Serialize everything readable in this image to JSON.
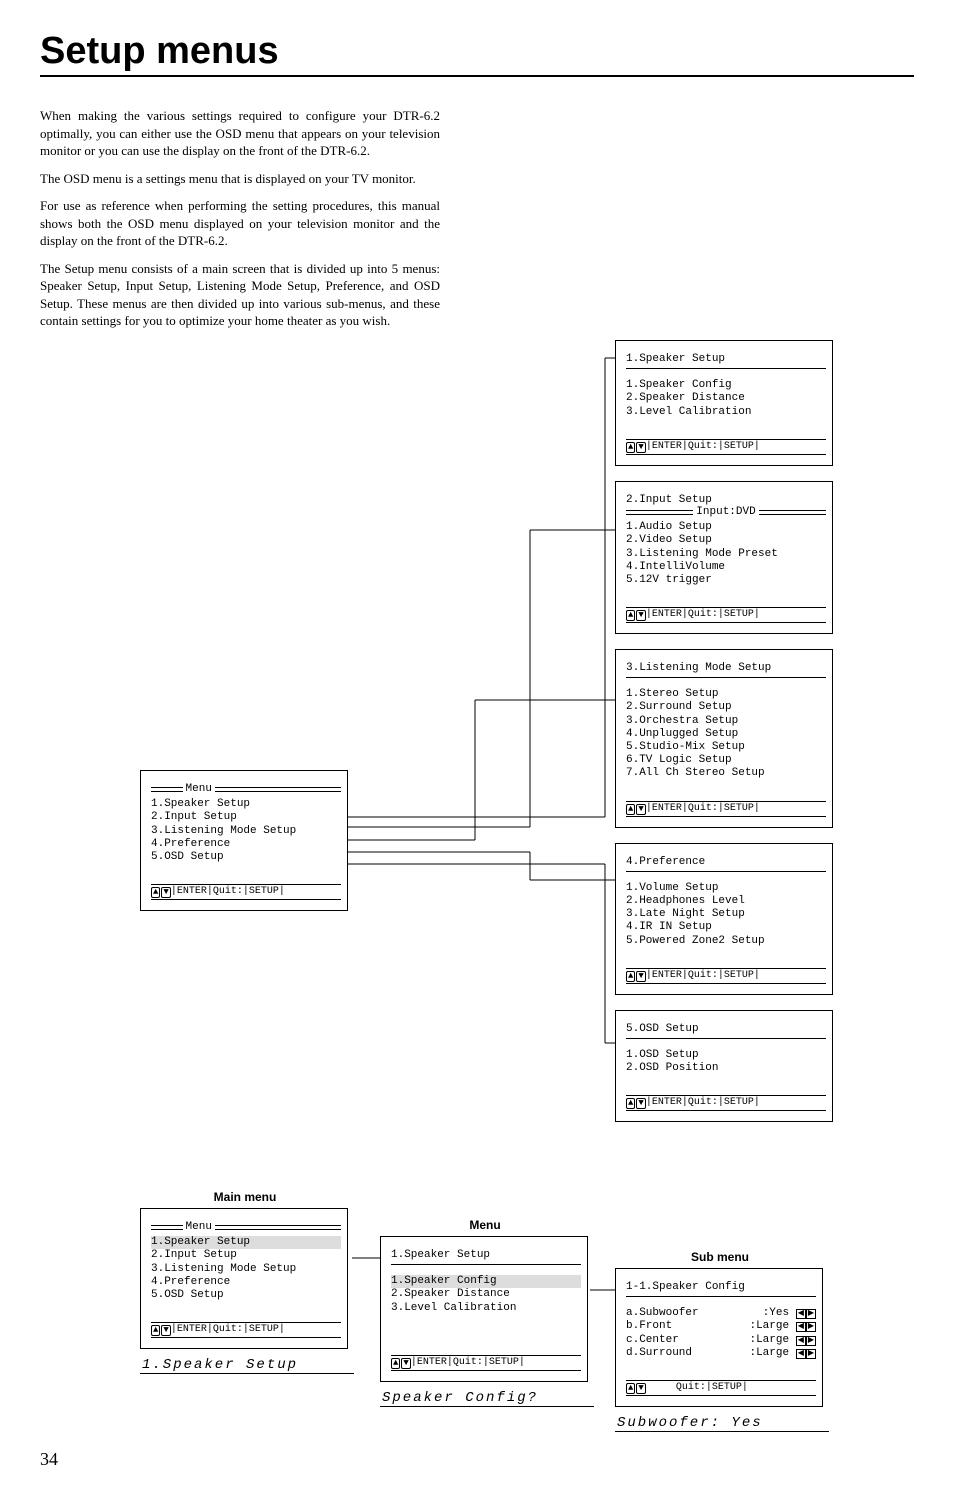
{
  "page_number": "34",
  "title": "Setup menus",
  "paragraphs": [
    "When making the various settings required to configure your DTR-6.2 optimally, you can either use the OSD menu that appears on your television monitor or you can use the display on the front of the DTR-6.2.",
    "The OSD menu is a settings menu that is displayed on your TV monitor.",
    "For use as reference when performing the setting procedures, this manual shows both the OSD menu displayed on your television monitor and the display on the front of the DTR-6.2.",
    "The Setup menu consists of a main screen that is divided up into 5 menus: Speaker Setup, Input Setup, Listening Mode Setup, Preference, and OSD Setup. These menus are then divided up into various sub-menus, and these contain settings for you to optimize your home theater as you wish."
  ],
  "footer_label": "|ENTER|Quit:|SETUP|",
  "footer_quit": "Quit:|SETUP|",
  "main_menu": {
    "title": "Menu",
    "items": [
      "1.Speaker Setup",
      "2.Input Setup",
      "3.Listening Mode Setup",
      "4.Preference",
      "5.OSD Setup"
    ]
  },
  "right_menus": [
    {
      "title": "1.Speaker Setup",
      "items": [
        "1.Speaker Config",
        "2.Speaker Distance",
        "3.Level Calibration"
      ]
    },
    {
      "title": "2.Input Setup",
      "subtitle": "Input:DVD",
      "items": [
        "1.Audio Setup",
        "2.Video Setup",
        "3.Listening Mode Preset",
        "4.IntelliVolume",
        "5.12V trigger"
      ]
    },
    {
      "title": "3.Listening Mode Setup",
      "items": [
        "1.Stereo Setup",
        "2.Surround Setup",
        "3.Orchestra Setup",
        "4.Unplugged Setup",
        "5.Studio-Mix Setup",
        "6.TV Logic Setup",
        "7.All Ch Stereo Setup"
      ]
    },
    {
      "title": "4.Preference",
      "items": [
        "1.Volume Setup",
        "2.Headphones Level",
        "3.Late Night Setup",
        "4.IR IN Setup",
        "5.Powered Zone2 Setup"
      ]
    },
    {
      "title": "5.OSD Setup",
      "items": [
        "1.OSD Setup",
        "2.OSD Position"
      ]
    }
  ],
  "captions": {
    "main": "Main menu",
    "menu": "Menu",
    "sub": "Sub menu"
  },
  "lower_main": {
    "title": "Menu",
    "items": [
      "1.Speaker Setup",
      "2.Input Setup",
      "3.Listening Mode Setup",
      "4.Preference",
      "5.OSD Setup"
    ],
    "selected": 0
  },
  "lower_mid": {
    "title": "1.Speaker Setup",
    "items": [
      "1.Speaker Config",
      "2.Speaker Distance",
      "3.Level Calibration"
    ],
    "selected": 0
  },
  "lower_sub": {
    "title": "1-1.Speaker Config",
    "rows": [
      {
        "k": "a.Subwoofer",
        "v": ":Yes"
      },
      {
        "k": "b.Front",
        "v": ":Large"
      },
      {
        "k": "c.Center",
        "v": ":Large"
      },
      {
        "k": "d.Surround",
        "v": ":Large"
      }
    ]
  },
  "lcd": {
    "a": "1.Speaker Setup",
    "b": "Speaker Config?",
    "c": "Subwoofer:  Yes"
  }
}
